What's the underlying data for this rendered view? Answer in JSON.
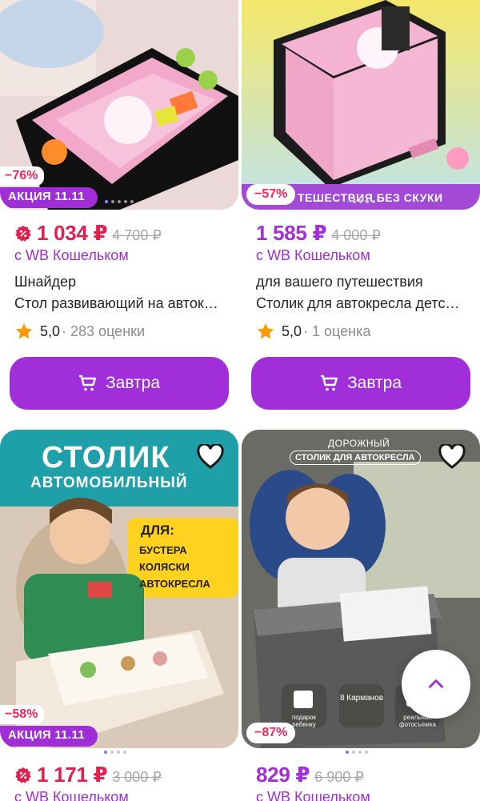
{
  "cards": [
    {
      "discount": "−76%",
      "promo": "АКЦИЯ 11.11",
      "price": "1 034 ₽",
      "old_price": "4 700 ₽",
      "wallet_text": "с WB Кошельком",
      "brand": "Шнайдер",
      "title": "Стол развивающий на автокресло",
      "rating_score": "5,0",
      "rating_count": "· 283 оценки",
      "button_label": "Завтра",
      "wallet_icon": true
    },
    {
      "discount": "−57%",
      "image_banner": "ТЕШЕСТВИЯ БЕЗ СКУКИ",
      "price": "1 585 ₽",
      "old_price": "4 000 ₽",
      "wallet_text": "с WB Кошельком",
      "brand": "для вашего путешествия",
      "title": "Столик для автокресла детский",
      "rating_score": "5,0",
      "rating_count": "· 1 оценка",
      "button_label": "Завтра",
      "wallet_icon": false
    },
    {
      "discount": "−58%",
      "promo": "АКЦИЯ 11.11",
      "image_heading": "СТОЛИК",
      "image_subheading": "АВТОМОБИЛЬНЫЙ",
      "image_for": "ДЛЯ:",
      "image_list": [
        "БУСТЕРА",
        "КОЛЯСКИ",
        "АВТОКРЕСЛА"
      ],
      "price": "1 171 ₽",
      "old_price": "3 000 ₽",
      "wallet_text": "с WB Кошельком",
      "wallet_icon": true
    },
    {
      "discount": "−87%",
      "image_top": "ДОРОЖНЫЙ",
      "image_pill": "СТОЛИК ДЛЯ АВТОКРЕСЛА",
      "image_features": [
        "подарок ребенку",
        "8 Карманов",
        "реальная фотосъемка"
      ],
      "price": "829 ₽",
      "old_price": "6 900 ₽",
      "wallet_text": "с WB Кошельком",
      "wallet_icon": false
    }
  ],
  "colors": {
    "accent": "#a12fd9",
    "sale": "#f0285b",
    "price_red": "#e0214f"
  },
  "icons": {
    "heart": "heart-icon",
    "cart": "cart-icon",
    "star": "star-icon",
    "wallet": "wallet-discount-icon",
    "up": "chevron-up-icon"
  }
}
